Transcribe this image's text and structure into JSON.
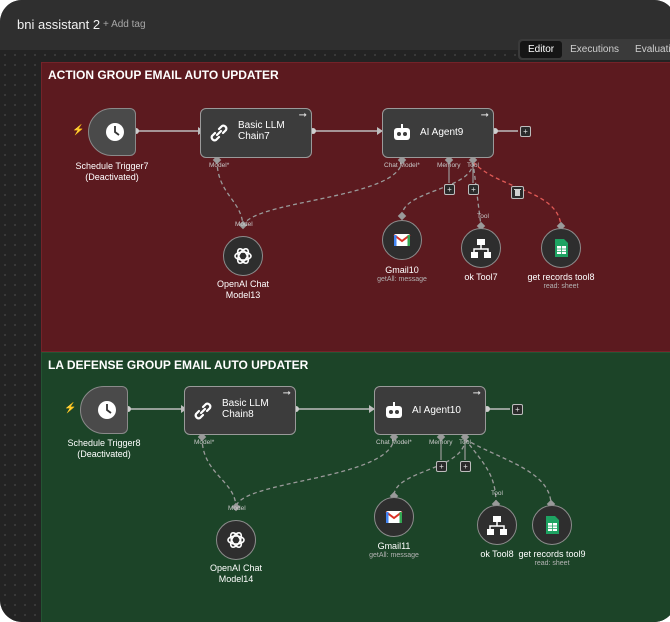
{
  "workflow": {
    "title": "bni assistant 2",
    "add_tag": "+ Add tag"
  },
  "tabs": [
    "Editor",
    "Executions",
    "Evaluation"
  ],
  "groups": [
    {
      "title": "ACTION GROUP EMAIL AUTO UPDATER",
      "trigger": {
        "name": "Schedule Trigger7",
        "state": "(Deactivated)"
      },
      "chain": {
        "line1": "Basic LLM",
        "line2": "Chain7",
        "port": "Model*"
      },
      "agent": {
        "name": "AI Agent9",
        "port_model": "Chat Model*",
        "port_memory": "Memory",
        "port_tool": "Tool"
      },
      "openai": {
        "line1": "OpenAI Chat",
        "line2": "Model13",
        "port": "Model"
      },
      "gmail": {
        "name": "Gmail10",
        "sub": "getAll: message"
      },
      "tool": {
        "name": "ok Tool7",
        "port": "Tool"
      },
      "sheet": {
        "name": "get records tool8",
        "sub": "read: sheet"
      }
    },
    {
      "title": "LA DEFENSE GROUP EMAIL AUTO UPDATER",
      "trigger": {
        "name": "Schedule Trigger8",
        "state": "(Deactivated)"
      },
      "chain": {
        "line1": "Basic LLM",
        "line2": "Chain8",
        "port": "Model*"
      },
      "agent": {
        "name": "AI Agent10",
        "port_model": "Chat Model*",
        "port_memory": "Memory",
        "port_tool": "Tool"
      },
      "openai": {
        "line1": "OpenAI Chat",
        "line2": "Model14",
        "port": "Model"
      },
      "gmail": {
        "name": "Gmail11",
        "sub": "getAll: message"
      },
      "tool": {
        "name": "ok Tool8",
        "port": "Tool"
      },
      "sheet": {
        "name": "get records tool9",
        "sub": "read: sheet"
      }
    }
  ],
  "icons": [
    "clock-icon",
    "link-icon",
    "robot-icon",
    "openai-icon",
    "gmail-icon",
    "network-icon",
    "sheets-icon",
    "trash-icon",
    "bolt-icon",
    "plus-icon"
  ],
  "colors": {
    "red_group": "#5c1a1f",
    "green_group": "#1c4428",
    "error_wire": "#e05a56",
    "sheets": "#1ea362"
  }
}
